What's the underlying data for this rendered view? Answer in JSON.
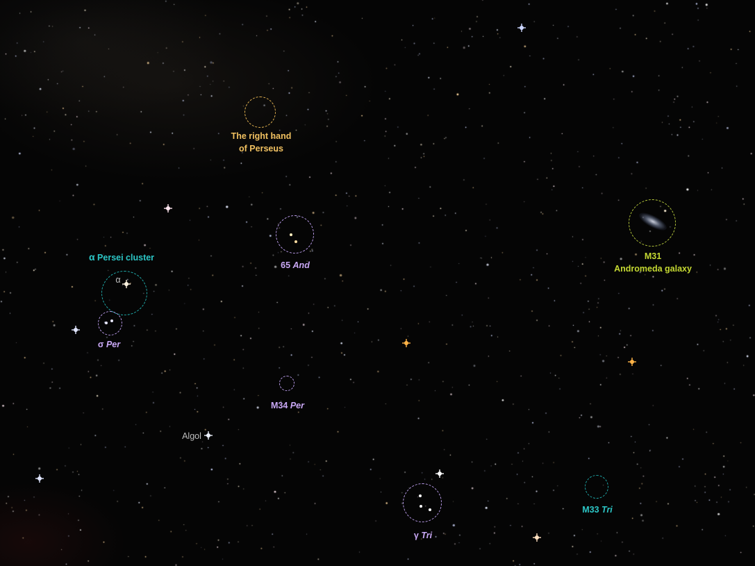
{
  "image": {
    "description_items": [
      {
        "id": "right-hand",
        "lines": [
          "The right hand",
          "of Perseus"
        ],
        "color": "#f0c060"
      },
      {
        "id": "65-and",
        "num": "65",
        "ital": "And",
        "color": "#c9a8f5"
      },
      {
        "id": "m31",
        "lines": [
          "M31",
          "Andromeda galaxy"
        ],
        "color": "#c4d832"
      },
      {
        "id": "alpha-persei",
        "sym": "α",
        "text": "Persei cluster",
        "color": "#2cc6c6"
      },
      {
        "id": "sigma-per",
        "sym": "σ",
        "ital": "Per",
        "color": "#c9a8f5"
      },
      {
        "id": "m34",
        "num": "M34",
        "ital": "Per",
        "color": "#c9a8f5"
      },
      {
        "id": "algol",
        "text": "Algol",
        "color": "#bdbdbd"
      },
      {
        "id": "gamma-tri",
        "sym": "γ",
        "ital": "Tri",
        "color": "#c9a8f5"
      },
      {
        "id": "m33",
        "num": "M33",
        "ital": "Tri",
        "color": "#2cc6c6"
      }
    ]
  },
  "labels": {
    "right_hand_l1": "The right hand",
    "right_hand_l2": "of Perseus",
    "and65_num": "65",
    "and65_const": "And",
    "m31_l1": "M31",
    "m31_l2": "Andromeda galaxy",
    "alpha_sym": "α",
    "alpha_text": "Persei cluster",
    "alpha_star": "α",
    "sigma_sym": "σ",
    "sigma_const": "Per",
    "m34_num": "M34",
    "m34_const": "Per",
    "algol": "Algol",
    "gamma_sym": "γ",
    "gamma_const": "Tri",
    "m33_num": "M33",
    "m33_const": "Tri"
  }
}
